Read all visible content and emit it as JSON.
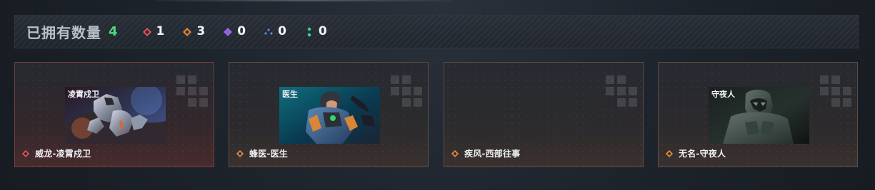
{
  "summary": {
    "title": "已拥有数量",
    "count": "4",
    "rarities": [
      {
        "icon": "red-diamond-icon",
        "value": "1",
        "color": "#d7555d"
      },
      {
        "icon": "orange-diamond-icon",
        "value": "3",
        "color": "#d88845"
      },
      {
        "icon": "purple-diamond-icon",
        "value": "0",
        "color": "#9267e2"
      },
      {
        "icon": "blue-triad-icon",
        "value": "0",
        "color": "#5f8fe2"
      },
      {
        "icon": "green-dots-icon",
        "value": "0",
        "color": "#42d58f"
      }
    ]
  },
  "cards": [
    {
      "name": "威龙-凌霄戍卫",
      "rarity_icon": "red-diamond-icon",
      "rarity_color": "#d7555d",
      "thumbnail_text": "凌霄戍卫",
      "thumbnail_icon": "armored-operator-icon"
    },
    {
      "name": "蜂医-医生",
      "rarity_icon": "orange-diamond-icon",
      "rarity_color": "#d88845",
      "thumbnail_text": "医生",
      "thumbnail_icon": "medic-operator-icon"
    },
    {
      "name": "疾风-西部往事",
      "rarity_icon": "orange-diamond-icon",
      "rarity_color": "#d88845",
      "thumbnail_text": "",
      "thumbnail_icon": "empty-thumbnail-icon"
    },
    {
      "name": "无名-守夜人",
      "rarity_icon": "orange-diamond-icon",
      "rarity_color": "#d88845",
      "thumbnail_text": "守夜人",
      "thumbnail_icon": "masked-operator-icon"
    }
  ]
}
